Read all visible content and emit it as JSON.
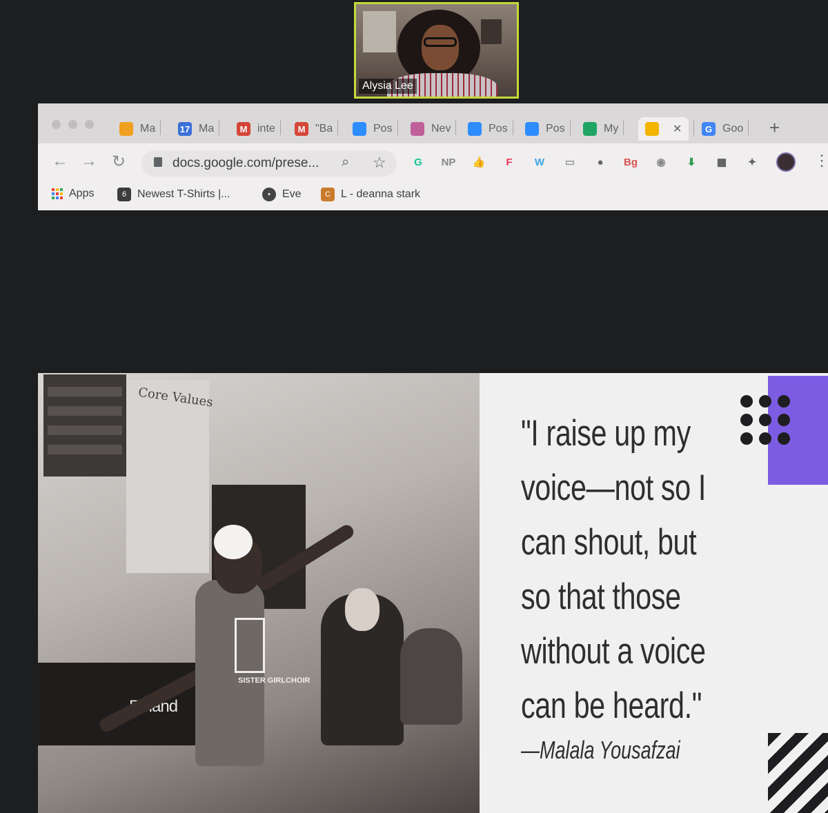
{
  "video_call": {
    "participant_name": "Alysia Lee"
  },
  "browser": {
    "tabs": [
      {
        "label": "Ma",
        "icon": "swirl-icon",
        "color": "#f0a020"
      },
      {
        "label": "Ma",
        "icon": "calendar-17-icon",
        "color": "#3a6fd8",
        "glyph": "17"
      },
      {
        "label": "inte",
        "icon": "gmail-icon",
        "color": "#d44638",
        "glyph": "M"
      },
      {
        "label": "\"Ba",
        "icon": "gmail-icon",
        "color": "#d44638",
        "glyph": "M"
      },
      {
        "label": "Pos",
        "icon": "zoom-icon",
        "color": "#2d8cff"
      },
      {
        "label": "Nev",
        "icon": "flower-icon",
        "color": "#c0609a"
      },
      {
        "label": "Pos",
        "icon": "zoom-icon",
        "color": "#2d8cff"
      },
      {
        "label": "Pos",
        "icon": "zoom-icon",
        "color": "#2d8cff"
      },
      {
        "label": "My",
        "icon": "drive-icon",
        "color": "#1fa463"
      },
      {
        "label": "",
        "icon": "slides-icon",
        "color": "#f4b400",
        "active": true
      },
      {
        "label": "Goo",
        "icon": "google-icon",
        "color": "#4285f4",
        "glyph": "G"
      }
    ],
    "new_tab_symbol": "+",
    "url": "docs.google.com/prese...",
    "extensions": [
      {
        "name": "grammarly-icon",
        "glyph": "G",
        "color": "#15c39a"
      },
      {
        "name": "np-icon",
        "glyph": "NP",
        "color": "#888888"
      },
      {
        "name": "thumbs-up-icon",
        "glyph": "👍",
        "color": "#f6c342"
      },
      {
        "name": "fontastic-icon",
        "glyph": "F",
        "color": "#e8375a"
      },
      {
        "name": "w-icon",
        "glyph": "W",
        "color": "#3aa7e0"
      },
      {
        "name": "tab-icon",
        "glyph": "▭",
        "color": "#9a9a9a"
      },
      {
        "name": "apple-icon",
        "glyph": "●",
        "color": "#666666"
      },
      {
        "name": "bg-icon",
        "glyph": "Bg",
        "color": "#d9534f"
      },
      {
        "name": "monkey-icon",
        "glyph": "◉",
        "color": "#8a8a8a"
      },
      {
        "name": "download-icon",
        "glyph": "⬇",
        "color": "#2e9b4f"
      },
      {
        "name": "grid-icon",
        "glyph": "▦",
        "color": "#555555"
      },
      {
        "name": "puzzle-icon",
        "glyph": "✦",
        "color": "#5f6368"
      }
    ],
    "bookmarks": [
      {
        "label": "Apps",
        "icon": "apps-grid-icon"
      },
      {
        "label": "Newest T-Shirts |...",
        "icon": "shirt-site-icon"
      },
      {
        "label": "Eve",
        "icon": "eve-icon"
      },
      {
        "label": "L - deanna stark",
        "icon": "l-site-icon"
      }
    ]
  },
  "slide": {
    "photo": {
      "wall_sign": "Core Values",
      "piano_brand": "Roland",
      "shirt_text": "SISTER GIRLCHOIR"
    },
    "quote_lines": [
      "\"I raise up my",
      "voice—not so I",
      "can shout, but",
      "so that those",
      "without a voice",
      "can be heard.\""
    ],
    "attribution": "—Malala Yousafzai",
    "accent_color": "#7c5ce2"
  }
}
